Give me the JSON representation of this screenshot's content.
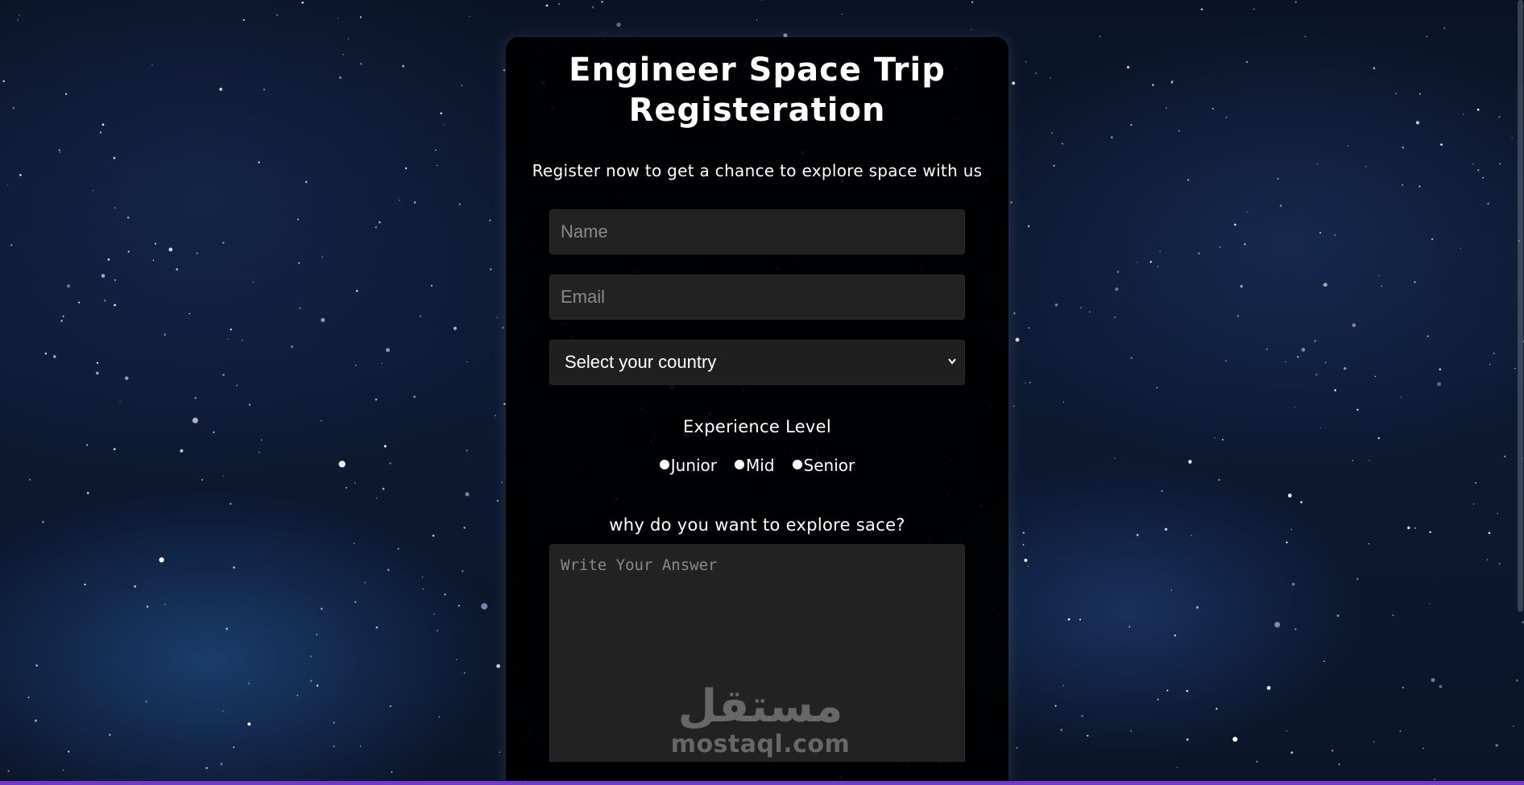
{
  "form": {
    "title_line1": "Engineer Space Trip",
    "title_line2": "Registeration",
    "subtitle": "Register now to get a chance to explore space with us",
    "name_placeholder": "Name",
    "email_placeholder": "Email",
    "country_select": {
      "selected": "Select your country"
    },
    "experience": {
      "label": "Experience Level",
      "options": [
        "Junior",
        "Mid",
        "Senior"
      ]
    },
    "question": "why do you want to explore sace?",
    "answer_placeholder": "Write Your Answer"
  },
  "watermark": {
    "arabic": "مستقل",
    "text": "mostaql.com"
  },
  "colors": {
    "card_bg": "#000000",
    "field_bg": "#222222",
    "accent_bar": "#6f3bc4",
    "text": "#ffffff",
    "placeholder": "#8a8a8a"
  }
}
